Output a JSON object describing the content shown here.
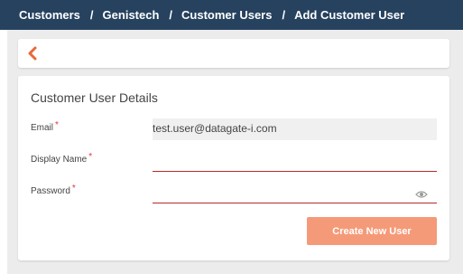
{
  "breadcrumb": {
    "items": [
      "Customers",
      "Genistech",
      "Customer Users",
      "Add Customer User"
    ],
    "separator": "/"
  },
  "backbar": {
    "icon": "chevron-left-icon"
  },
  "form": {
    "title": "Customer User Details",
    "email": {
      "label": "Email",
      "value": "test.user@datagate-i.com",
      "required_mark": "*"
    },
    "display_name": {
      "label": "Display Name",
      "value": "",
      "required_mark": "*"
    },
    "password": {
      "label": "Password",
      "value": "",
      "required_mark": "*",
      "icon": "eye-icon"
    },
    "submit_label": "Create New User"
  },
  "colors": {
    "topbar": "#26425f",
    "accent": "#e8683a",
    "button": "#f59a78",
    "required": "#e0363a",
    "underline": "#b52a2a"
  }
}
